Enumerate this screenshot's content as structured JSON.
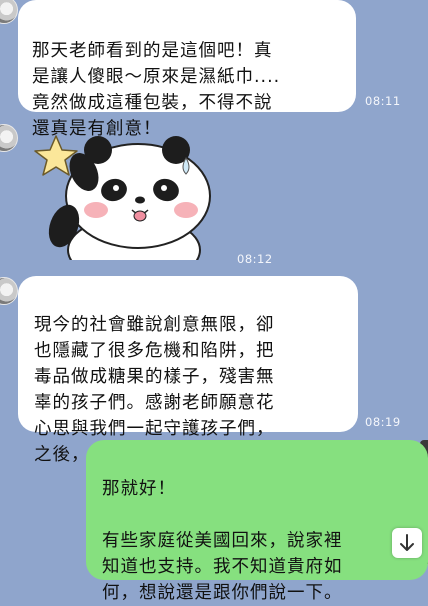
{
  "messages": [
    {
      "text": "那天老師看到的是這個吧！真\n是讓人傻眼～原來是濕紙巾....\n竟然做成這種包裝，不得不說\n還真是有創意！",
      "time": "08:11"
    },
    {
      "sticker": "panda-star-sticker",
      "time": "08:12"
    },
    {
      "text": "現今的社會雖說創意無限，卻\n也隱藏了很多危機和陷阱，把\n毒品做成糖果的樣子，殘害無\n辜的孩子們。感謝老師願意花\n心思與我們一起守護孩子們，\n之後，也請多多關照！感恩～",
      "time": "08:19"
    },
    {
      "text": "那就好！\n\n有些家庭從美國回來，說家裡\n知道也支持。我不知道貴府如\n何，想說還是跟你們說一下。"
    }
  ],
  "colors": {
    "background": "#8fa5cc",
    "incoming_bubble": "#ffffff",
    "outgoing_bubble": "#86e07f"
  },
  "icons": {
    "scroll_down": "arrow-down-icon"
  }
}
